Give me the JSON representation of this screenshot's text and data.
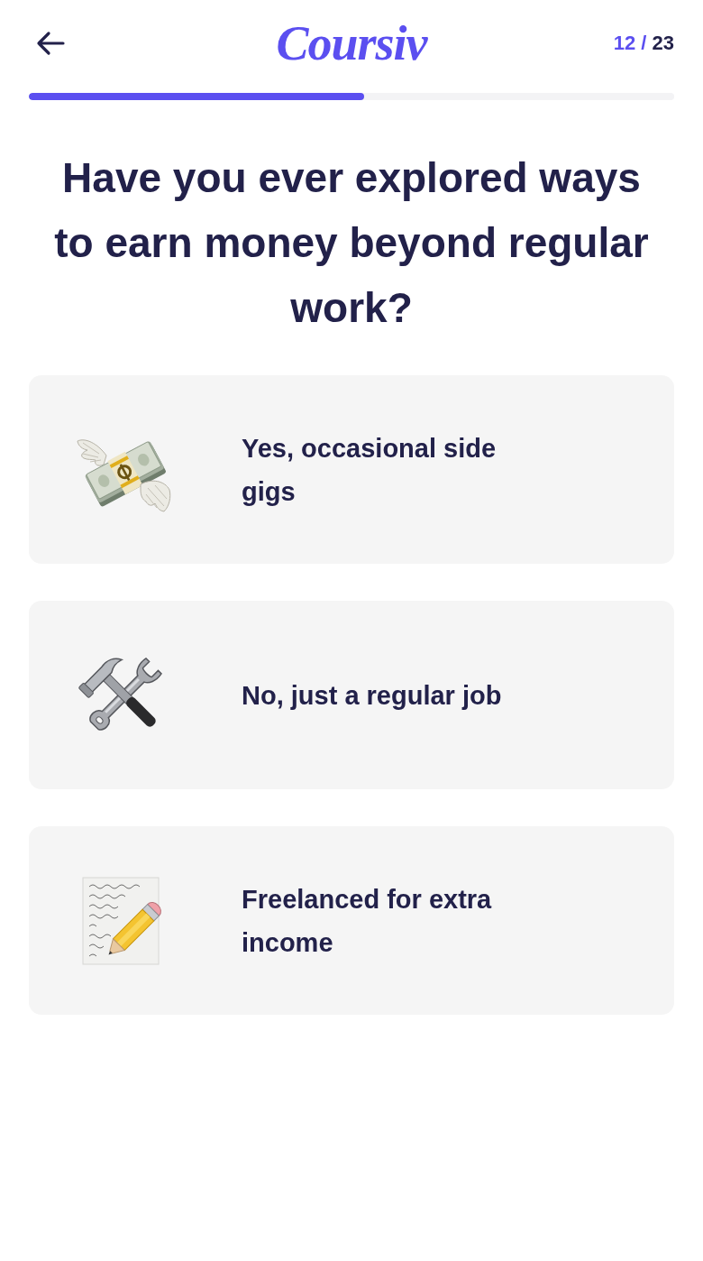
{
  "logo": "Coursiv",
  "step_counter": {
    "current": "12",
    "separator": "/",
    "total": "23"
  },
  "progress": {
    "level": 0.52
  },
  "question": "Have you ever explored ways to earn money beyond regular work?",
  "options": [
    {
      "label": "Yes, occasional side gigs",
      "selected": false
    },
    {
      "label": "No, just a regular job",
      "selected": false
    },
    {
      "label": "Freelanced for extra income",
      "selected": false
    }
  ]
}
